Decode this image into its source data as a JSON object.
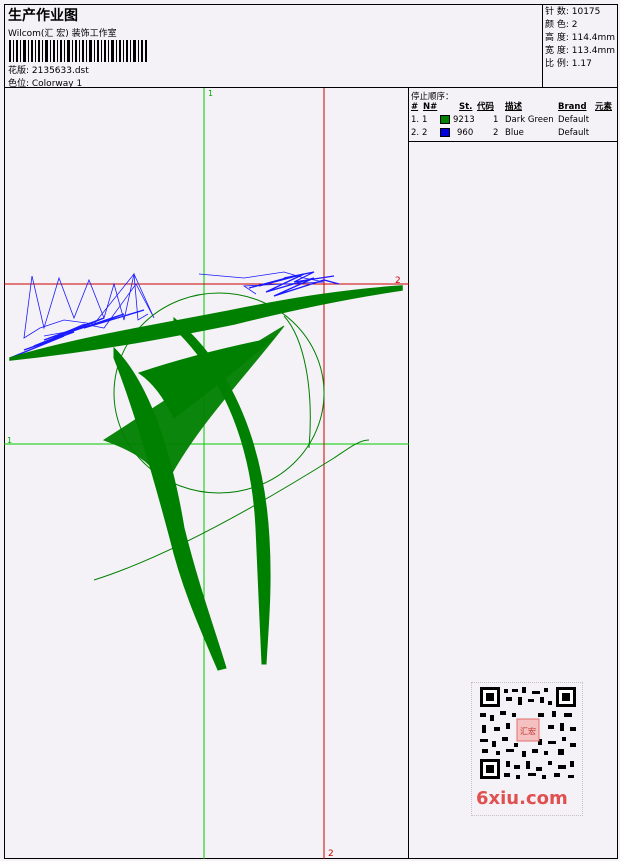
{
  "header": {
    "title": "生产作业图",
    "line1": "Wilcom(汇  宏) 装饰工作室",
    "design_label": "花版: 2135633.dst",
    "colorway_label": "色位:  Colorway 1"
  },
  "stats": {
    "stitches": "针  数:  10175",
    "colors": "颜  色:  2",
    "height": "高  度:  114.4mm",
    "width": "宽  度:  113.4mm",
    "ratio": "比  例:  1.17"
  },
  "canvas": {
    "guide_v1": "1",
    "guide_h1": "1",
    "guide_v2": "2",
    "guide_h2": "2",
    "guide_color_green": "#00cc00",
    "guide_color_red": "#cc0000"
  },
  "stop_sequence": {
    "title": "停止顺序：",
    "headers": [
      "#",
      "N#",
      "St.",
      "代码",
      "描述",
      "Brand",
      "元素"
    ],
    "rows": [
      {
        "index": "1.",
        "num": "1",
        "swatch": "#008000",
        "stitches": "9213",
        "code": "1",
        "desc": "Dark Green",
        "brand": "Default"
      },
      {
        "index": "2.",
        "num": "2",
        "swatch": "#0000dd",
        "stitches": "960",
        "code": "2",
        "desc": "Blue",
        "brand": "Default"
      }
    ]
  },
  "watermark": {
    "text": "6xiu.com",
    "badge": "汇宏"
  },
  "colors": {
    "green": "#008000",
    "blue": "#1a1aff"
  }
}
